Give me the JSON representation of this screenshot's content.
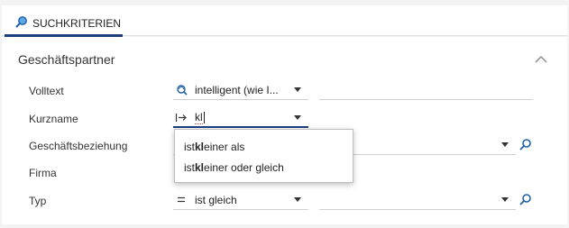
{
  "tab": {
    "label": "SUCHKRITERIEN"
  },
  "section": {
    "title": "Geschäftspartner"
  },
  "rows": [
    {
      "label": "Volltext",
      "operator": "intelligent (wie I...",
      "value": ""
    },
    {
      "label": "Kurzname",
      "operator": "",
      "value": "kl"
    },
    {
      "label": "Geschäftsbeziehung",
      "operator": "",
      "value": ""
    },
    {
      "label": "Firma",
      "operator": "",
      "value": ""
    },
    {
      "label": "Typ",
      "operator": "ist gleich",
      "value": ""
    }
  ],
  "dropdown": {
    "options": [
      {
        "pre": "ist ",
        "match": "kl",
        "post": "einer als"
      },
      {
        "pre": "ist ",
        "match": "kl",
        "post": "einer oder gleich"
      }
    ]
  },
  "colors": {
    "tab_underline": "#1c3f7e",
    "accent_icon": "#1f5fa8"
  }
}
